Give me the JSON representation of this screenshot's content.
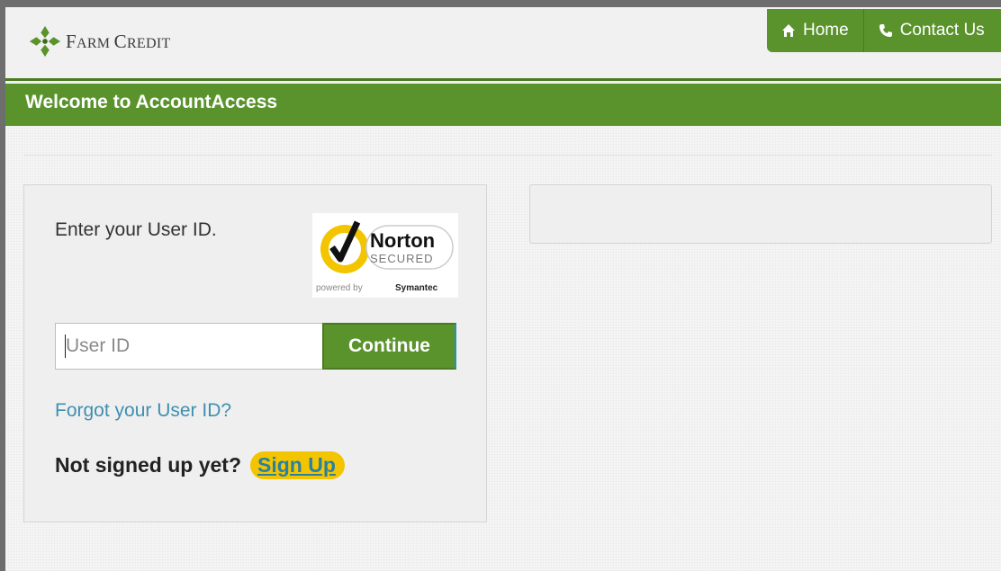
{
  "header": {
    "logo_text_first": "F",
    "logo_text_rest": "ARM ",
    "logo_text_second_first": "C",
    "logo_text_second_rest": "REDIT",
    "nav": [
      {
        "label": "Home",
        "icon": "home-icon"
      },
      {
        "label": "Contact Us",
        "icon": "phone-icon"
      }
    ]
  },
  "banner": {
    "title": "Welcome to AccountAccess"
  },
  "login": {
    "prompt": "Enter your User ID.",
    "user_id": {
      "placeholder": "User ID",
      "value": ""
    },
    "continue_label": "Continue",
    "forgot_label": "Forgot your User ID?",
    "signup_question": "Not signed up yet?",
    "signup_label": "Sign Up"
  },
  "norton": {
    "brand": "Norton",
    "secured": "SECURED",
    "powered_by": "powered by",
    "vendor": "Symantec"
  },
  "colors": {
    "brand_green": "#5a932c",
    "link_blue": "#3f8fb0",
    "highlight": "#f2c500"
  }
}
